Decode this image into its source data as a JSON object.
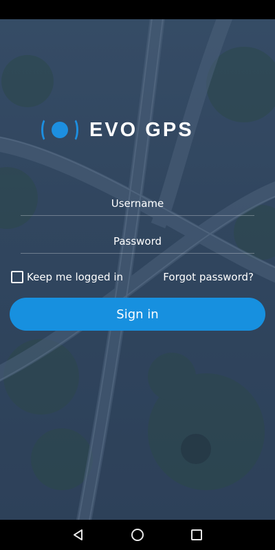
{
  "app": {
    "brand_name": "EVO GPS",
    "accent_color": "#1790df"
  },
  "login": {
    "username_placeholder": "Username",
    "password_placeholder": "Password",
    "remember_label": "Keep me logged in",
    "remember_checked": false,
    "forgot_label": "Forgot password?",
    "signin_label": "Sign in"
  },
  "nav": {
    "back_icon": "triangle-back-icon",
    "home_icon": "circle-home-icon",
    "recents_icon": "square-recents-icon"
  }
}
